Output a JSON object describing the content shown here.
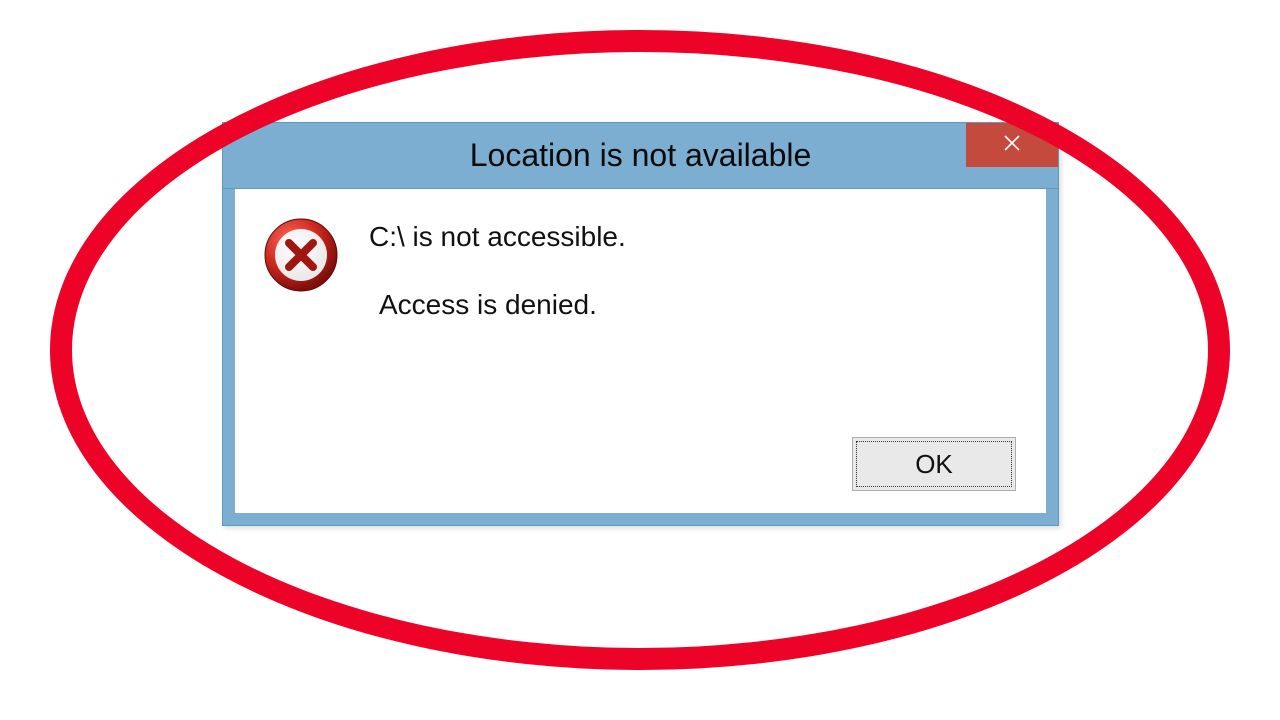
{
  "dialog": {
    "title": "Location is not available",
    "close_icon": "close-icon",
    "error_icon": "error-circle-x-icon",
    "message_primary": "C:\\ is not accessible.",
    "message_secondary": "Access is denied.",
    "ok_label": "OK"
  },
  "colors": {
    "titlebar": "#7baed0",
    "close_button": "#c44a3e",
    "annotation": "#ed0228"
  }
}
